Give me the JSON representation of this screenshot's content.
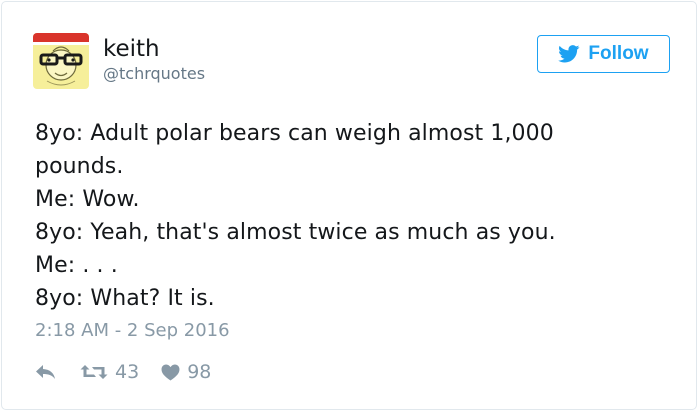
{
  "user": {
    "name": "keith",
    "handle": "@tchrquotes",
    "avatar_icon": "cartoon-face-with-glasses-icon"
  },
  "follow_button": {
    "label": "Follow",
    "icon": "twitter-bird-icon",
    "color": "#1da1f2"
  },
  "tweet": {
    "lines": [
      "8yo: Adult polar bears can weigh almost 1,000",
      "pounds.",
      "Me: Wow.",
      "8yo: Yeah, that's almost twice as much as you.",
      "Me: . . .",
      "8yo: What? It is."
    ],
    "timestamp": "2:18 AM - 2 Sep 2016"
  },
  "actions": {
    "reply_icon": "reply-icon",
    "retweet_icon": "retweet-icon",
    "retweet_count": "43",
    "like_icon": "heart-icon",
    "like_count": "98"
  },
  "colors": {
    "text": "#14171a",
    "muted": "#8899a6",
    "border": "#e1e8ed"
  }
}
